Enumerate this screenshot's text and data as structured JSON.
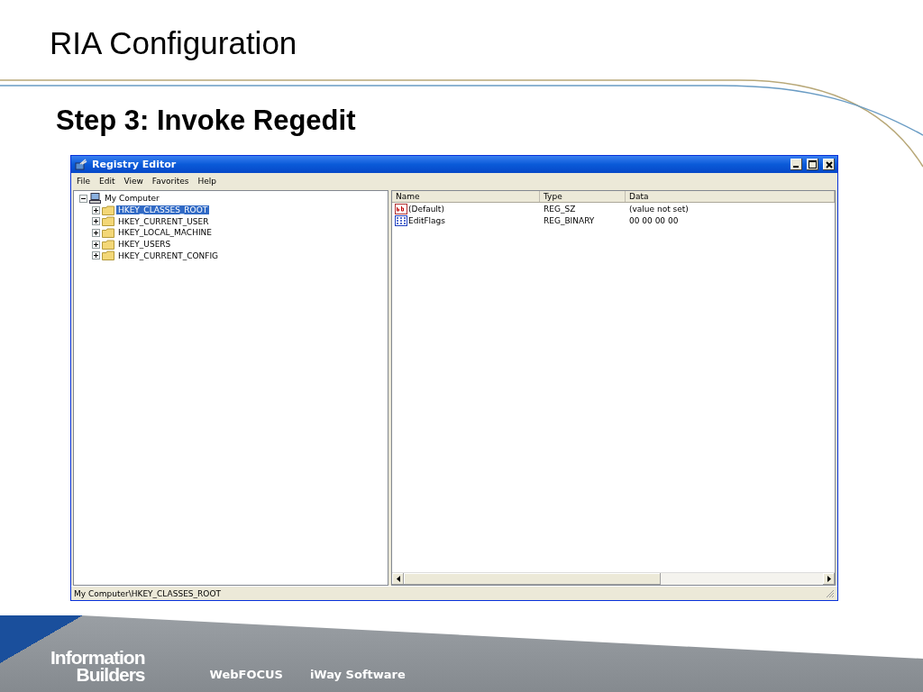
{
  "slide": {
    "title": "RIA Configuration",
    "subtitle": "Step 3: Invoke Regedit"
  },
  "window": {
    "title": "Registry Editor",
    "menu": [
      "File",
      "Edit",
      "View",
      "Favorites",
      "Help"
    ]
  },
  "tree": [
    {
      "label": "My Computer",
      "expanded": true,
      "selected": false,
      "children": [
        {
          "label": "HKEY_CLASSES_ROOT",
          "expanded": false,
          "selected": true
        },
        {
          "label": "HKEY_CURRENT_USER",
          "expanded": false,
          "selected": false
        },
        {
          "label": "HKEY_LOCAL_MACHINE",
          "expanded": false,
          "selected": false
        },
        {
          "label": "HKEY_USERS",
          "expanded": false,
          "selected": false
        },
        {
          "label": "HKEY_CURRENT_CONFIG",
          "expanded": false,
          "selected": false
        }
      ]
    }
  ],
  "values": {
    "columns": [
      "Name",
      "Type",
      "Data"
    ],
    "rows": [
      {
        "kind": "string",
        "name": "(Default)",
        "type": "REG_SZ",
        "data": "(value not set)"
      },
      {
        "kind": "binary",
        "name": "EditFlags",
        "type": "REG_BINARY",
        "data": "00 00 00 00"
      }
    ]
  },
  "status_bar": "My Computer\\HKEY_CLASSES_ROOT",
  "footer": {
    "logo": [
      "Information",
      "Builders"
    ],
    "products": [
      "WebFOCUS",
      "iWay Software"
    ]
  }
}
